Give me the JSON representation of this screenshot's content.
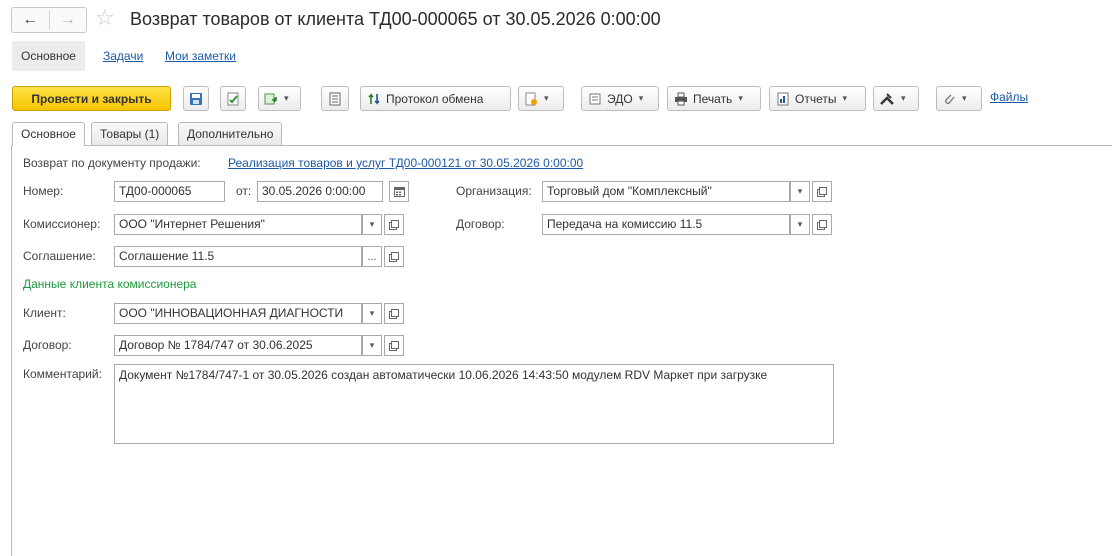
{
  "window": {
    "title": "Возврат товаров от клиента ТД00-000065 от 30.05.2026 0:00:00",
    "back_glyph": "←",
    "forward_glyph": "→",
    "star_glyph": "☆"
  },
  "sections": {
    "main": "Основное",
    "tasks": "Задачи",
    "notes": "Мои заметки"
  },
  "toolbar": {
    "post_close": "Провести и закрыть",
    "exchange_log": "Протокол обмена",
    "edo": "ЭДО",
    "print": "Печать",
    "reports": "Отчеты",
    "files": "Файлы",
    "caret": "▾"
  },
  "tabs": {
    "main": "Основное",
    "goods": "Товары (1)",
    "additional": "Дополнительно"
  },
  "form": {
    "return_label": "Возврат по документу продажи:",
    "return_link": "Реализация товаров и услуг ТД00-000121 от 30.05.2026 0:00:00",
    "number_label": "Номер:",
    "number_value": "ТД00-000065",
    "from_label": "от:",
    "date_value": "30.05.2026  0:00:00",
    "org_label": "Организация:",
    "org_value": "Торговый дом \"Комплексный\"",
    "commissioner_label": "Комиссионер:",
    "commissioner_value": "ООО \"Интернет Решения\"",
    "contract_label": "Договор:",
    "contract_value": "Передача на комиссию 11.5",
    "agreement_label": "Соглашение:",
    "agreement_value": "Соглашение 11.5",
    "client_section": "Данные клиента комиссионера",
    "client_label": "Клиент:",
    "client_value": "ООО \"ИННОВАЦИОННАЯ ДИАГНОСТИ",
    "client_contract_label": "Договор:",
    "client_contract_value": "Договор № 1784/747 от 30.06.2025",
    "comment_label": "Комментарий:",
    "comment_value": "Документ №1784/747-1 от 30.05.2026 создан автоматически 10.06.2026 14:43:50 модулем RDV Маркет при загрузке"
  },
  "colors": {
    "primary": "#f5c400",
    "link": "#1d5aa6",
    "section_green": "#1e9a3c"
  }
}
